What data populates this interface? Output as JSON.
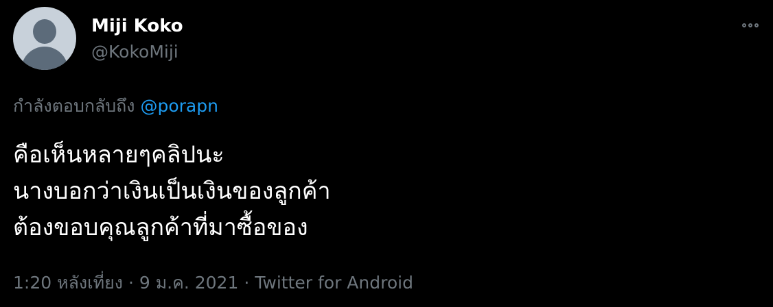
{
  "author": {
    "display_name": "Miji Koko",
    "handle": "@KokoMiji",
    "avatar_icon": "default-profile-icon"
  },
  "more_icon": "more-horizontal-icon",
  "reply": {
    "prefix": "กำลังตอบกลับถึง",
    "mention": "@porapn"
  },
  "tweet": {
    "lines": [
      "คือเห็นหลายๆคลิปนะ",
      "นางบอกว่าเงินเป็นเงินของลูกค้า",
      "ต้องขอบคุณลูกค้าที่มาซื้อของ"
    ]
  },
  "meta": {
    "time": "1:20 หลังเที่ยง",
    "separator": "·",
    "date": "9 ม.ค. 2021",
    "source": "Twitter for Android"
  },
  "colors": {
    "background": "#000000",
    "text_primary": "#ffffff",
    "text_secondary": "#6e767d",
    "link": "#1d9bf0"
  }
}
